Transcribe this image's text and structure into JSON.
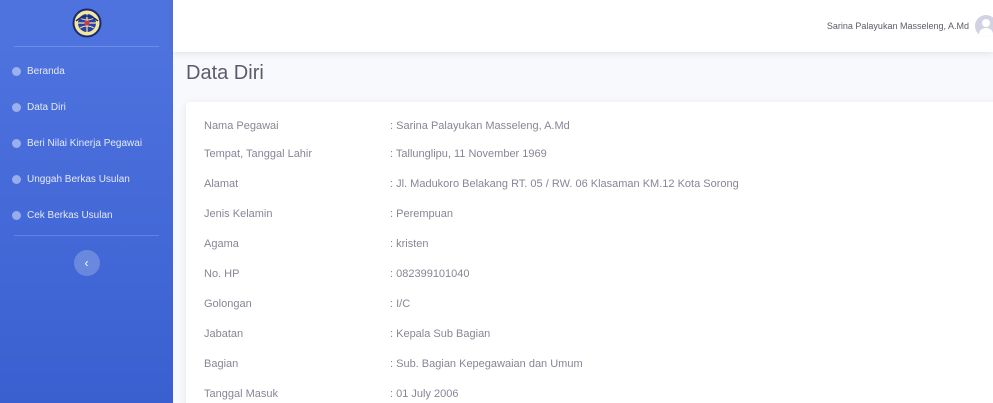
{
  "sidebar": {
    "items": [
      {
        "label": "Beranda"
      },
      {
        "label": "Data Diri"
      },
      {
        "label": "Beri Nilai Kinerja Pegawai"
      },
      {
        "label": "Unggah Berkas Usulan"
      },
      {
        "label": "Cek Berkas Usulan"
      }
    ],
    "toggle_icon": "‹"
  },
  "header": {
    "user_name": "Sarina Palayukan Masseleng, A.Md"
  },
  "page": {
    "title": "Data Diri"
  },
  "profile": {
    "rows": [
      {
        "label": "Nama Pegawai",
        "value": ": Sarina Palayukan Masseleng, A.Md"
      },
      {
        "label": "Tempat, Tanggal Lahir",
        "value": ": Tallunglipu, 11 November 1969"
      },
      {
        "label": "Alamat",
        "value": ": Jl. Madukoro Belakang RT. 05 / RW. 06 Klasaman KM.12 Kota Sorong"
      },
      {
        "label": "Jenis Kelamin",
        "value": ": Perempuan"
      },
      {
        "label": "Agama",
        "value": ": kristen"
      },
      {
        "label": "No. HP",
        "value": ": 082399101040"
      },
      {
        "label": "Golongan",
        "value": ": I/C"
      },
      {
        "label": "Jabatan",
        "value": ": Kepala Sub Bagian"
      },
      {
        "label": "Bagian",
        "value": ": Sub. Bagian Kepegawaian dan Umum"
      },
      {
        "label": "Tanggal Masuk",
        "value": ": 01 July 2006"
      }
    ]
  },
  "colors": {
    "sidebar": "#4e73df",
    "text": "#858796",
    "title": "#5a5c69"
  }
}
